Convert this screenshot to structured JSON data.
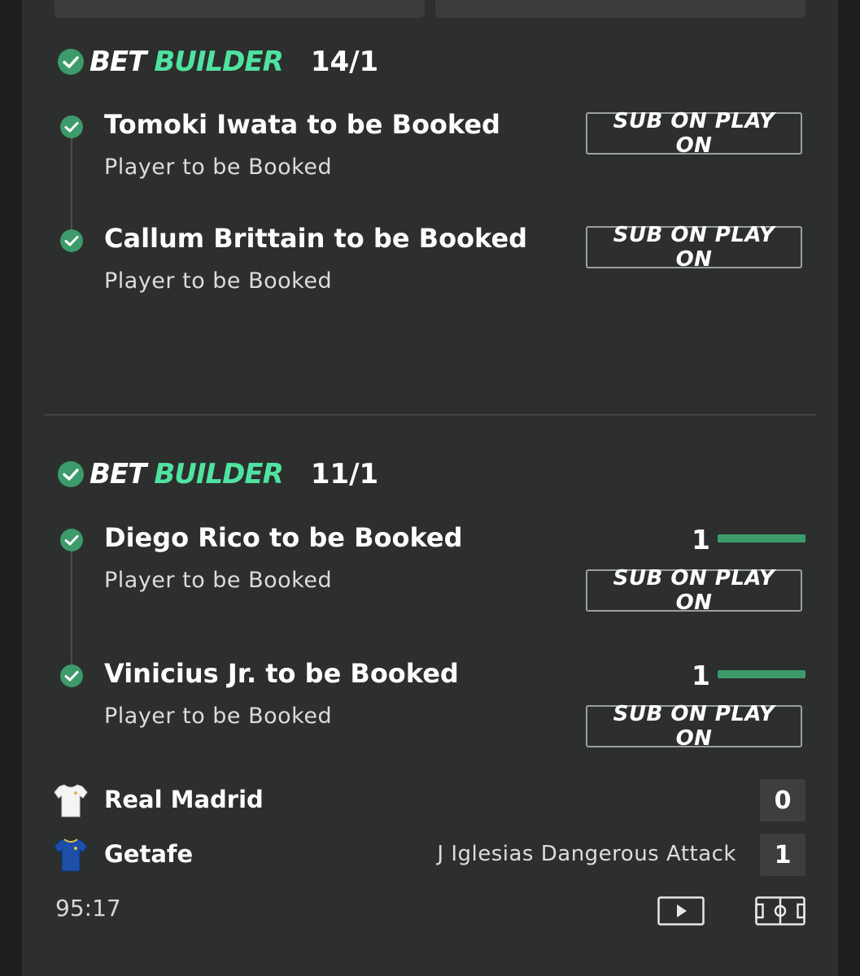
{
  "colors": {
    "accent_green": "#4fe3a0",
    "check_green": "#3d9a6b",
    "panel_bg": "#2c2f2d",
    "page_bg": "#1d1f1e"
  },
  "bet_builders": [
    {
      "title_bet": "BET",
      "title_builder": "BUILDER",
      "odds": "14/1",
      "legs": [
        {
          "title": "Tomoki Iwata to be Booked",
          "subtitle": "Player to be Booked",
          "button": "SUB ON PLAY ON"
        },
        {
          "title": "Callum Brittain to be Booked",
          "subtitle": "Player to be Booked",
          "button": "SUB ON PLAY ON"
        }
      ]
    },
    {
      "title_bet": "BET",
      "title_builder": "BUILDER",
      "odds": "11/1",
      "legs": [
        {
          "title": "Diego Rico to be Booked",
          "subtitle": "Player to be Booked",
          "progress_value": "1",
          "progress_fraction": 1.0,
          "button": "SUB ON PLAY ON"
        },
        {
          "title": "Vinicius Jr. to be Booked",
          "subtitle": "Player to be Booked",
          "progress_value": "1",
          "progress_fraction": 1.0,
          "button": "SUB ON PLAY ON"
        }
      ]
    }
  ],
  "match": {
    "home": {
      "name": "Real Madrid",
      "score": "0",
      "kit_icon": "white-shirt-icon"
    },
    "away": {
      "name": "Getafe",
      "score": "1",
      "kit_icon": "blue-shirt-icon",
      "event": "J Iglesias Dangerous Attack"
    },
    "clock": "95:17",
    "icons": [
      "play-video-icon",
      "pitch-icon"
    ]
  }
}
